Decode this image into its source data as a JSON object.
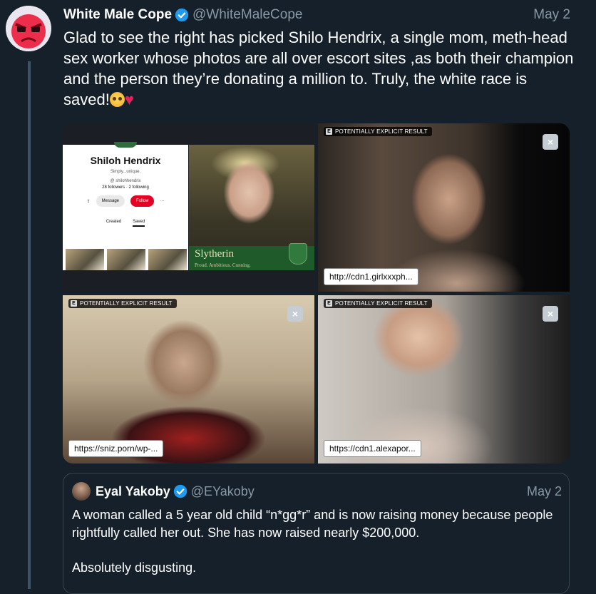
{
  "tweet": {
    "author_name": "White Male Cope",
    "author_handle": "@WhiteMaleCope",
    "date": "May 2",
    "text": "Glad to see the right has picked Shilo Hendrix, a single mom, meth-head sex worker whose photos are all over escort sites ,as both their champion and the person they’re donating a million to. Truly, the white race is saved!",
    "emoji_1": "pleading-face",
    "emoji_2": "♥",
    "verified_icon": "verified-badge-icon"
  },
  "media": {
    "explicit_label": "POTENTIALLY EXPLICIT RESULT",
    "explicit_icon_letter": "E",
    "close_icon": "×",
    "image1": {
      "profile_name": "Shiloh Hendrix",
      "profile_bio": "Simply...unique.",
      "profile_handle": "@ shilohhendrix",
      "profile_counts": "28 followers · 2 following",
      "message_label": "Message",
      "follow_label": "Follow",
      "more_label": "···",
      "share_label": "⇪",
      "tab_created": "Created",
      "tab_saved": "Saved",
      "house_title": "Slytherin",
      "house_motto": "Proud. Ambitious. Cunning."
    },
    "image2": {
      "url": "http://cdn1.girlxxxph..."
    },
    "image3": {
      "url": "https://sniz.porn/wp-..."
    },
    "image4": {
      "url": "https://cdn1.alexapor..."
    }
  },
  "quote": {
    "author_name": "Eyal Yakoby",
    "author_handle": "@EYakoby",
    "date": "May 2",
    "paragraph1": "A woman called a 5 year old child “n*gg*r” and is now raising money because people rightfully called her out. She has now raised nearly $200,000.",
    "paragraph2": "Absolutely disgusting."
  },
  "colors": {
    "background": "#15202b",
    "verified": "#1d9bf0",
    "secondary_text": "#8899a6",
    "thread_line": "#3d5466",
    "follow_red": "#e60023"
  }
}
